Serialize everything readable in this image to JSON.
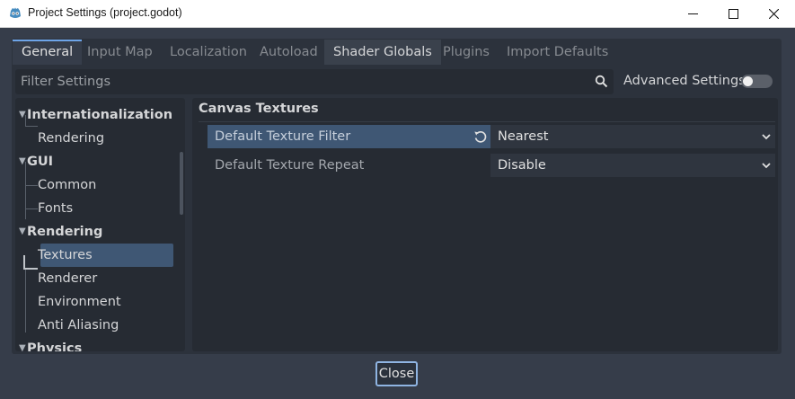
{
  "window": {
    "title": "Project Settings (project.godot)",
    "controls": [
      "minimize-icon",
      "maximize-icon",
      "close-icon"
    ]
  },
  "tabs": [
    {
      "label": "General",
      "state": "active"
    },
    {
      "label": "Input Map",
      "state": "inactive"
    },
    {
      "label": "Localization",
      "state": "inactive"
    },
    {
      "label": "Autoload",
      "state": "inactive"
    },
    {
      "label": "Shader Globals",
      "state": "hover"
    },
    {
      "label": "Plugins",
      "state": "inactive"
    },
    {
      "label": "Import Defaults",
      "state": "inactive"
    }
  ],
  "filter": {
    "placeholder": "Filter Settings",
    "value": ""
  },
  "advanced_settings": {
    "label": "Advanced Settings",
    "enabled": false
  },
  "tree": {
    "items": [
      {
        "label": "Internationalization",
        "type": "section",
        "expanded": true
      },
      {
        "label": "Rendering",
        "type": "item"
      },
      {
        "label": "GUI",
        "type": "section",
        "expanded": true
      },
      {
        "label": "Common",
        "type": "item"
      },
      {
        "label": "Fonts",
        "type": "item"
      },
      {
        "label": "Rendering",
        "type": "section",
        "expanded": true
      },
      {
        "label": "Textures",
        "type": "item",
        "selected": true
      },
      {
        "label": "Renderer",
        "type": "item"
      },
      {
        "label": "Environment",
        "type": "item"
      },
      {
        "label": "Anti Aliasing",
        "type": "item"
      },
      {
        "label": "Physics",
        "type": "section",
        "expanded": true
      }
    ]
  },
  "inspector": {
    "section": "Canvas Textures",
    "properties": [
      {
        "name": "Default Texture Filter",
        "value": "Nearest",
        "modified": true
      },
      {
        "name": "Default Texture Repeat",
        "value": "Disable",
        "modified": false
      }
    ]
  },
  "footer": {
    "close_label": "Close"
  },
  "colors": {
    "accent": "#6da4e8",
    "selection": "#3f5774",
    "background": "#363d4a",
    "panel": "#262b33"
  }
}
